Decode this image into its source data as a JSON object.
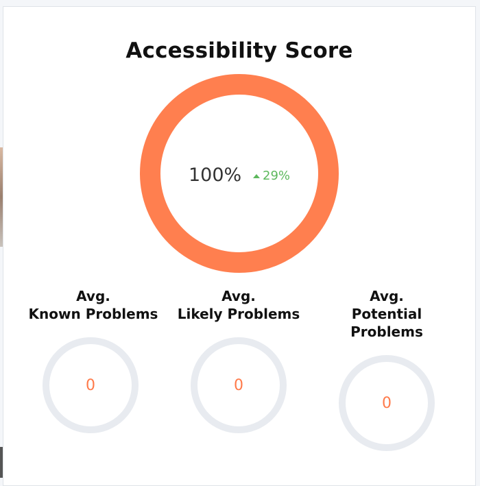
{
  "card": {
    "title": "Accessibility Score"
  },
  "score": {
    "value": "100%",
    "delta": "29%",
    "delta_direction": "up",
    "percent": 100,
    "ring_color": "#ff7f4f",
    "delta_color": "#5cb85c"
  },
  "metrics": [
    {
      "label_lines": [
        "Avg.",
        "Known Problems"
      ],
      "value": "0"
    },
    {
      "label_lines": [
        "Avg.",
        "Likely Problems"
      ],
      "value": "0"
    },
    {
      "label_lines": [
        "Avg.",
        "Potential",
        "Problems"
      ],
      "value": "0"
    }
  ],
  "colors": {
    "empty_ring": "#e8ebf0",
    "metric_value": "#ff7a4a"
  }
}
